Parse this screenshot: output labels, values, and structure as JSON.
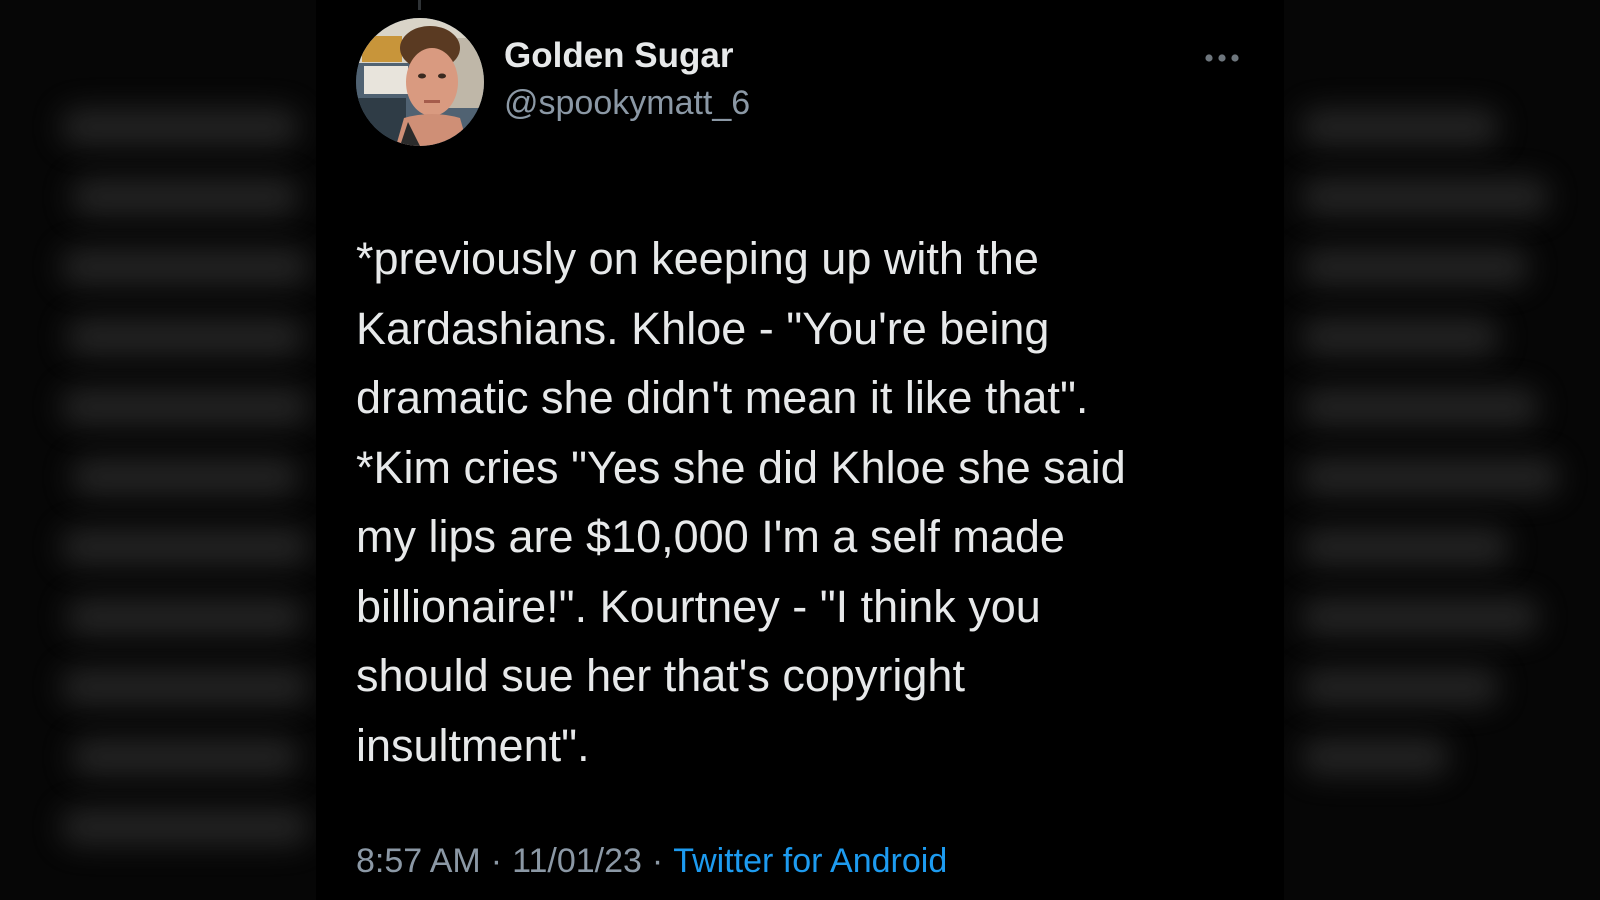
{
  "tweet": {
    "author": {
      "display_name": "Golden Sugar",
      "handle": "@spookymatt_6"
    },
    "text": "*previously on keeping up with the\nKardashians. Khloe - \"You're being\ndramatic she didn't mean it like that\".\n*Kim cries \"Yes she did Khloe she said\nmy lips are $10,000 I'm a self made\nbillionaire!\". Kourtney - \"I think you\nshould sue her that's copyright\ninsultment\".",
    "time": "8:57 AM",
    "date": "11/01/23",
    "separator": "·",
    "source": "Twitter for Android"
  },
  "icons": {
    "more": "more-horizontal-icon",
    "avatar": "avatar"
  },
  "colors": {
    "background": "#000000",
    "text_primary": "#e7e9ea",
    "text_secondary": "#8b98a5",
    "link": "#1d9bf0"
  }
}
